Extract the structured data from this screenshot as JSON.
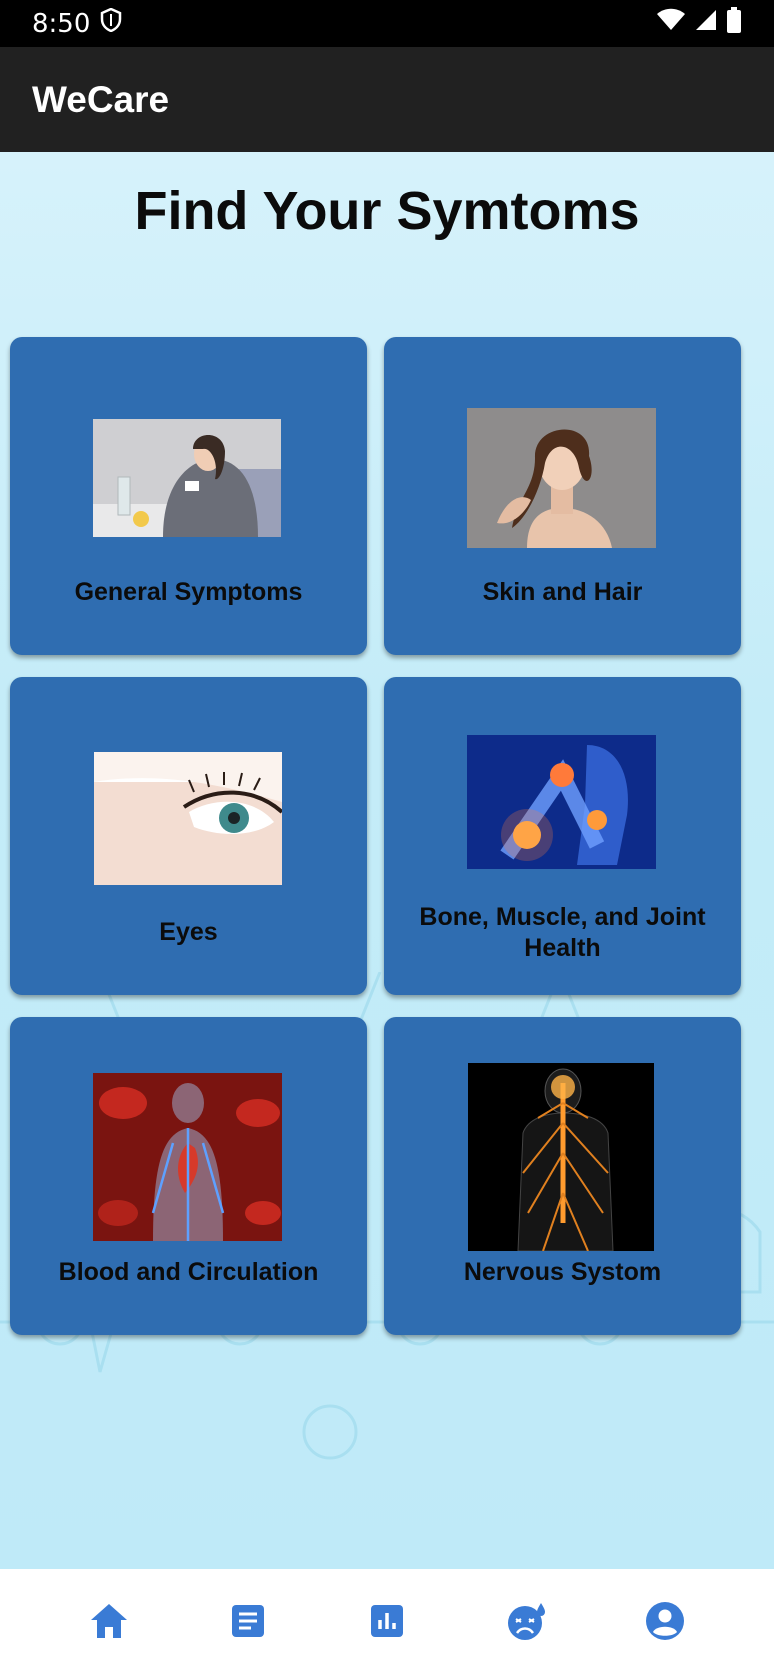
{
  "status_bar": {
    "time": "8:50"
  },
  "app_bar": {
    "title": "WeCare"
  },
  "page": {
    "title": "Find Your Symtoms"
  },
  "categories": [
    {
      "label": "General Symptoms"
    },
    {
      "label": "Skin and Hair"
    },
    {
      "label": "Eyes"
    },
    {
      "label": "Bone, Muscle, and Joint Health"
    },
    {
      "label": "Blood and Circulation"
    },
    {
      "label": "Nervous Systom"
    }
  ],
  "bottom_nav": {
    "items": [
      "home-icon",
      "article-icon",
      "chart-icon",
      "sick-face-icon",
      "account-icon"
    ],
    "accent_color": "#3a7bd5"
  },
  "colors": {
    "card": "#2f6db1",
    "app_bar": "#212121"
  }
}
